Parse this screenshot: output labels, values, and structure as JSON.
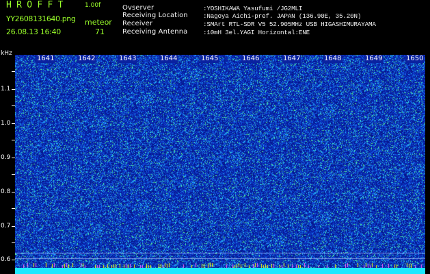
{
  "header": {
    "app_title": "HROFFT",
    "version": "1.00f",
    "file_name": "YY2608131640.png",
    "timestamp": "26.08.13 16:40",
    "meteor_label": "meteor",
    "meteor_count": "71"
  },
  "station_info": [
    {
      "key": "Ovserver",
      "value": ":YOSHIKAWA Yasufumi /JG2MLI"
    },
    {
      "key": "Receiving Location",
      "value": ":Nagoya Aichi-pref. JAPAN (136.90E, 35.20N)"
    },
    {
      "key": "Receiver",
      "value": ":SMArt RTL-SDR V5 52.905MHz USB HIGASHIMURAYAMA"
    },
    {
      "key": "Receiving Antenna",
      "value": ":10mH 3el.YAGI Horizontal:ENE"
    }
  ],
  "axis": {
    "unit": "kHz",
    "freq_labels": [
      "1.1",
      "1.0",
      "0.9",
      "0.8",
      "0.7",
      "0.6"
    ],
    "minute_labels": [
      "1641",
      "1642",
      "1643",
      "1644",
      "1645",
      "1646",
      "1647",
      "1648",
      "1649",
      "1650"
    ]
  },
  "colors": {
    "text_green": "#9aff2a",
    "text_white": "#f2f2f2",
    "background": "#000000",
    "spectrogram_blue": "#0a22a0",
    "noise_cyan": "#1ee8ff",
    "marker_yellow": "#ffff00"
  }
}
